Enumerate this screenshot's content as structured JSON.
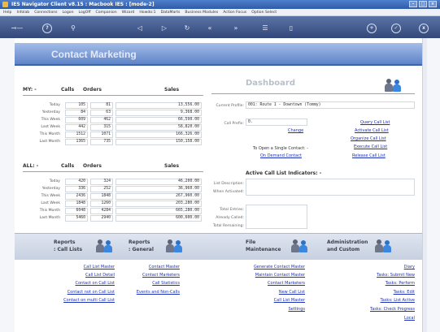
{
  "window": {
    "title": "IES Navigator Client v8.15 : Macbook IES :      [mode-2]"
  },
  "menu": [
    "Help",
    "Infolab",
    "Connections",
    "Logon",
    "LogOff",
    "Companion",
    "Wizard",
    "Howdo:1",
    "DataMarts",
    "Business Modules",
    "Action Focus",
    "Option Select"
  ],
  "toolbar": {
    "icons": [
      "key-icon",
      "help-icon",
      "search-icon",
      "back-icon",
      "forward-icon",
      "refresh-icon",
      "history-back-icon",
      "history-forward-icon",
      "menu-icon",
      "window-icon",
      "add-icon",
      "ok-icon",
      "close-icon"
    ],
    "help_glyph": "?",
    "add_glyph": "+",
    "ok_glyph": "✓",
    "close_glyph": "x"
  },
  "page": {
    "title": "Contact Marketing"
  },
  "my": {
    "title": "MY: -",
    "col_calls": "Calls",
    "col_orders": "Orders",
    "col_sales": "Sales",
    "rows": [
      {
        "label": "Today",
        "calls": "105",
        "orders": "81",
        "sales": "13,556.00"
      },
      {
        "label": "Yesterday",
        "calls": "84",
        "orders": "63",
        "sales": "9,368.00"
      },
      {
        "label": "This Week",
        "calls": "609",
        "orders": "462",
        "sales": "66,590.00"
      },
      {
        "label": "Last Week",
        "calls": "442",
        "orders": "315",
        "sales": "58,820.00"
      },
      {
        "label": "This Month",
        "calls": "1512",
        "orders": "1071",
        "sales": "166,326.00"
      },
      {
        "label": "Last Month",
        "calls": "1365",
        "orders": "735",
        "sales": "150,158.00"
      }
    ]
  },
  "all": {
    "title": "ALL: -",
    "col_calls": "Calls",
    "col_orders": "Orders",
    "col_sales": "Sales",
    "rows": [
      {
        "label": "Today",
        "calls": "420",
        "orders": "324",
        "sales": "46,200.00"
      },
      {
        "label": "Yesterday",
        "calls": "336",
        "orders": "252",
        "sales": "36,960.00"
      },
      {
        "label": "This Week",
        "calls": "2436",
        "orders": "1848",
        "sales": "267,960.00"
      },
      {
        "label": "Last Week",
        "calls": "1848",
        "orders": "1260",
        "sales": "203,280.00"
      },
      {
        "label": "This Month",
        "calls": "6048",
        "orders": "4284",
        "sales": "665,280.00"
      },
      {
        "label": "Last Month",
        "calls": "5460",
        "orders": "2940",
        "sales": "600,600.00"
      }
    ]
  },
  "dashboard": {
    "title": "Dashboard",
    "current_profile_label": "Current Profile:",
    "current_profile_value": "001: Route 1 - Downtown (Tommy)",
    "call_prefix_label": "Call Prefix:",
    "call_prefix_value": "0.",
    "change_link": "Change",
    "links": [
      "Query Call List",
      "Activate Call List",
      "Organize Call List",
      "Execute Call List",
      "Release Call List"
    ],
    "single_contact_text": "To Open a Single Contact: -",
    "on_demand_link": "On Demand Contact",
    "indicators_title": "Active Call List Indicators: -",
    "list_description_label": "List Description:",
    "when_activated_label": "When Activated:",
    "total_entries_label": "Total Entries:",
    "already_called_label": "Already Called:",
    "total_remaining_label": "Total Remaining:"
  },
  "bottom": {
    "reports_calllists": {
      "line1": "Reports",
      "line2": ": Call Lists"
    },
    "reports_general": {
      "line1": "Reports",
      "line2": ": General"
    },
    "file_maintenance": {
      "line1": "File",
      "line2": "Maintenance"
    },
    "admin_custom": {
      "line1": "Administration",
      "line2": "and Custom"
    }
  },
  "links": {
    "call_lists": [
      "Call List Master",
      "Call List Detail",
      "Contact on Call List",
      "Contact not on Call List",
      "Contact on multi Call List"
    ],
    "general": [
      "Contact Master",
      "Contact Marketers",
      "Call Statistics",
      "Events and Non-Calls"
    ],
    "maintenance": [
      "Generate Contact Master",
      "Maintain Contact Master",
      "Contact Marketers",
      "New Call List",
      "Call List Master",
      "Settings"
    ],
    "admin": [
      "Diary",
      "Tasks: Submit New",
      "Tasks: Perform",
      "Tasks: Edit",
      "Tasks: List Active",
      "Tasks: Check Progress",
      "Local"
    ]
  }
}
